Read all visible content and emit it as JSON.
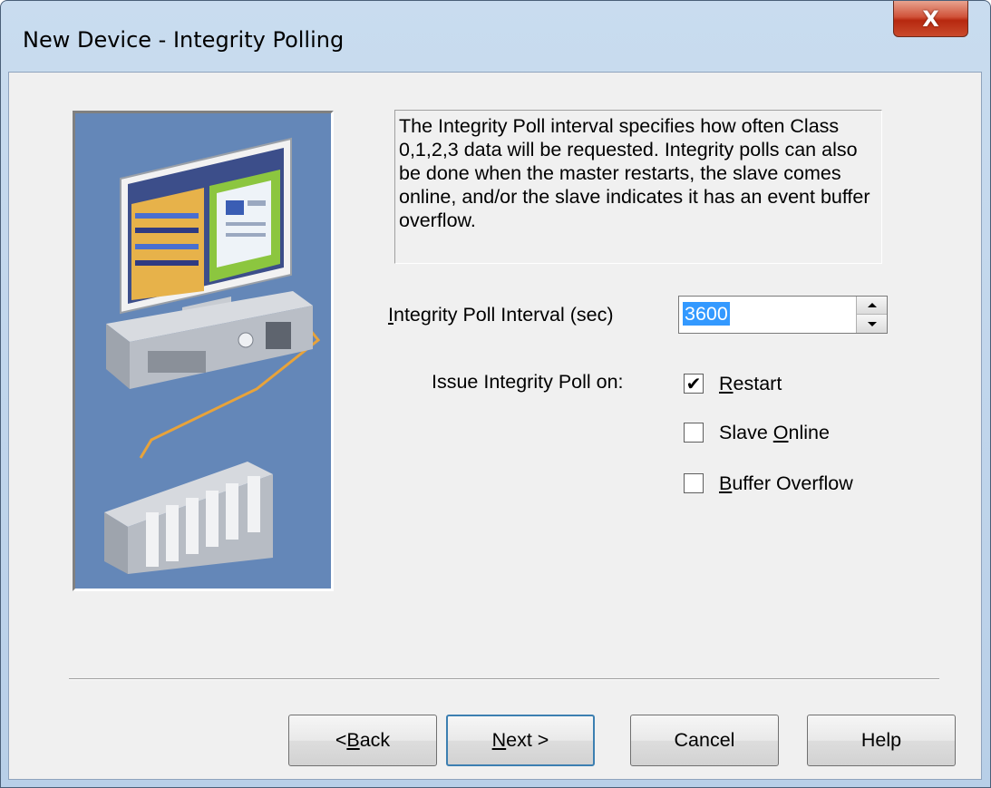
{
  "window": {
    "title": "New Device - Integrity Polling",
    "close_glyph": "X"
  },
  "description": "The Integrity Poll interval specifies how often Class 0,1,2,3 data will be requested.   Integrity polls can also be done when the master restarts, the slave comes online, and/or the slave indicates it has an event buffer overflow.",
  "interval": {
    "label_prefix": "",
    "label_access_key": "I",
    "label_rest": "ntegrity Poll Interval (sec)",
    "value": "3600"
  },
  "issue": {
    "label": "Issue Integrity Poll on:",
    "options": [
      {
        "access_key": "R",
        "rest": "estart",
        "prefix": "",
        "checked": true
      },
      {
        "access_key": "O",
        "rest": "nline",
        "prefix": "Slave ",
        "checked": false
      },
      {
        "access_key": "B",
        "rest": "uffer Overflow",
        "prefix": "",
        "checked": false
      }
    ]
  },
  "buttons": {
    "back_prefix": "< ",
    "back_key": "B",
    "back_rest": "ack",
    "next_key": "N",
    "next_rest": "ext >",
    "cancel": "Cancel",
    "help": "Help"
  },
  "icons": {
    "illustration": "computer-and-plc-illustration",
    "check_mark": "✔"
  },
  "colors": {
    "illustration_bg": "#6487b8",
    "selection": "#3399ff",
    "default_button_border": "#3c7fb1"
  }
}
